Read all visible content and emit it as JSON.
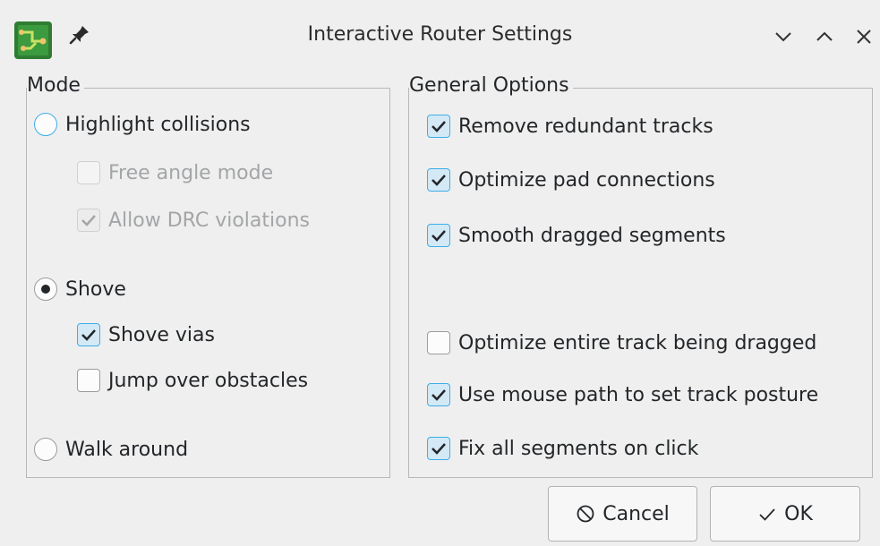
{
  "window": {
    "title": "Interactive Router Settings",
    "icons": [
      "kicad-pcb-app-icon",
      "pin-icon",
      "minimize-icon",
      "maximize-icon",
      "close-icon"
    ]
  },
  "mode": {
    "label": "Mode",
    "highlight_collisions": "Highlight collisions",
    "free_angle_mode": "Free angle mode",
    "allow_drc_violations": "Allow DRC violations",
    "shove": "Shove",
    "shove_vias": "Shove vias",
    "jump_over_obstacles": "Jump over obstacles",
    "walk_around": "Walk around",
    "selected": "Shove",
    "free_angle_checked": false,
    "allow_drc_checked": true,
    "shove_vias_checked": true,
    "jump_over_checked": false
  },
  "general": {
    "label": "General Options",
    "options": [
      {
        "label": "Remove redundant tracks",
        "checked": true
      },
      {
        "label": "Optimize pad connections",
        "checked": true
      },
      {
        "label": "Smooth dragged segments",
        "checked": true
      },
      {
        "label": "Optimize entire track being dragged",
        "checked": false
      },
      {
        "label": "Use mouse path to set track posture",
        "checked": true
      },
      {
        "label": "Fix all segments on click",
        "checked": true
      }
    ]
  },
  "buttons": {
    "cancel": "Cancel",
    "ok": "OK"
  },
  "colors": {
    "accent": "#3daee9",
    "check_fill": "#d4e9f6",
    "window_bg": "#efefef"
  }
}
